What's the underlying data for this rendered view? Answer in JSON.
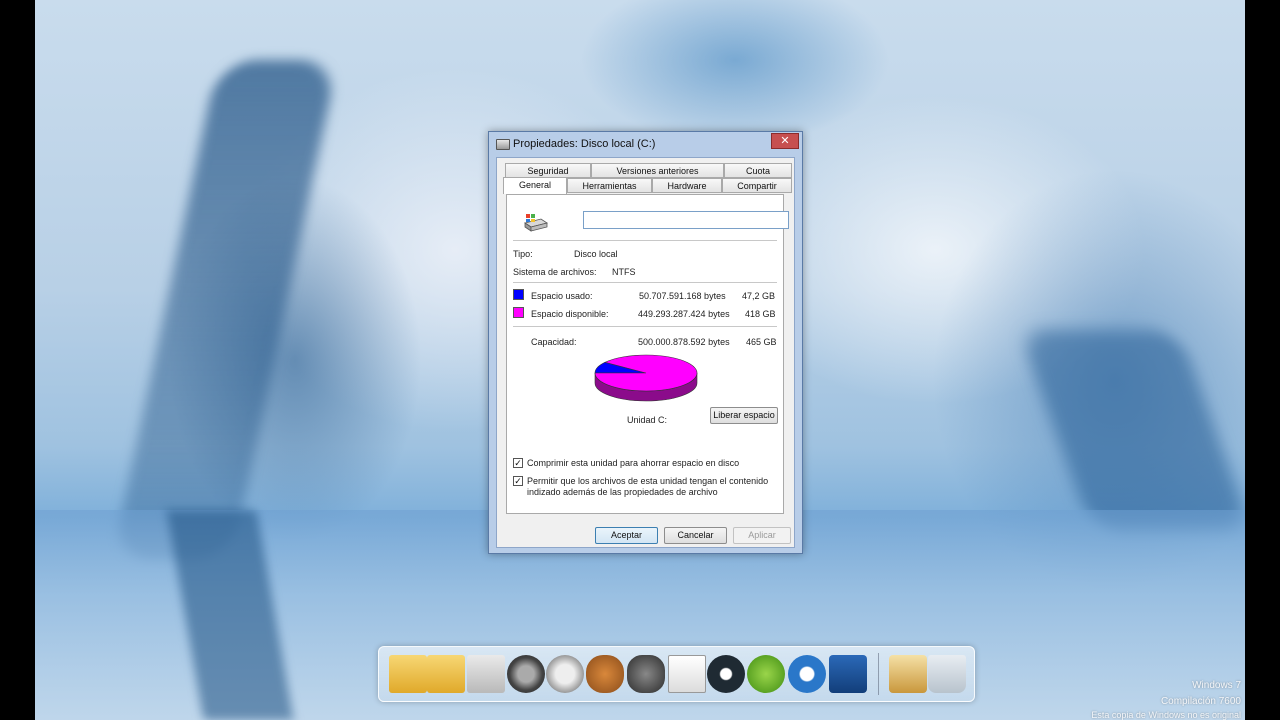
{
  "window": {
    "title": "Propiedades: Disco local (C:)",
    "close_label": "✕"
  },
  "tabs_row1": [
    {
      "label": "Seguridad"
    },
    {
      "label": "Versiones anteriores"
    },
    {
      "label": "Cuota"
    }
  ],
  "tabs_row2": [
    {
      "label": "General",
      "active": true
    },
    {
      "label": "Herramientas"
    },
    {
      "label": "Hardware"
    },
    {
      "label": "Compartir"
    }
  ],
  "general": {
    "volume_name_value": "",
    "type_label": "Tipo:",
    "type_value": "Disco local",
    "fs_label": "Sistema de archivos:",
    "fs_value": "NTFS",
    "used_label": "Espacio usado:",
    "used_bytes": "50.707.591.168 bytes",
    "used_size": "47,2 GB",
    "free_label": "Espacio disponible:",
    "free_bytes": "449.293.287.424 bytes",
    "free_size": "418 GB",
    "capacity_label": "Capacidad:",
    "capacity_bytes": "500.000.878.592 bytes",
    "capacity_size": "465 GB",
    "drive_label": "Unidad C:",
    "cleanup_button": "Liberar espacio",
    "compress_label": "Comprimir esta unidad para ahorrar espacio en disco",
    "compress_checked": true,
    "index_label_line1": "Permitir que los archivos de esta unidad tengan el contenido",
    "index_label_line2": "indizado además de las propiedades de archivo",
    "index_checked": true
  },
  "colors": {
    "used": "#0000ff",
    "free": "#ff00ff"
  },
  "chart_data": {
    "type": "pie",
    "labels": [
      "Espacio usado",
      "Espacio disponible"
    ],
    "values": [
      47.2,
      418
    ],
    "unit": "GB"
  },
  "footer": {
    "ok": "Aceptar",
    "cancel": "Cancelar",
    "apply": "Aplicar"
  },
  "dock_items": [
    {
      "name": "folder-icon"
    },
    {
      "name": "downloads-folder-icon"
    },
    {
      "name": "settings-panel-icon"
    },
    {
      "name": "speedometer-icon"
    },
    {
      "name": "speaker-icon"
    },
    {
      "name": "glove-icon"
    },
    {
      "name": "wolf-icon"
    },
    {
      "name": "document-icon"
    },
    {
      "name": "gear-c-icon"
    },
    {
      "name": "utorrent-icon"
    },
    {
      "name": "lightning-icon"
    },
    {
      "name": "rocketdock-icon"
    },
    {
      "name": "tools-icon"
    },
    {
      "name": "recycle-bin-icon"
    }
  ],
  "watermark": {
    "line1": "Windows 7",
    "line2": "Compilación 7600",
    "line3": "Esta copia de Windows no es original"
  }
}
